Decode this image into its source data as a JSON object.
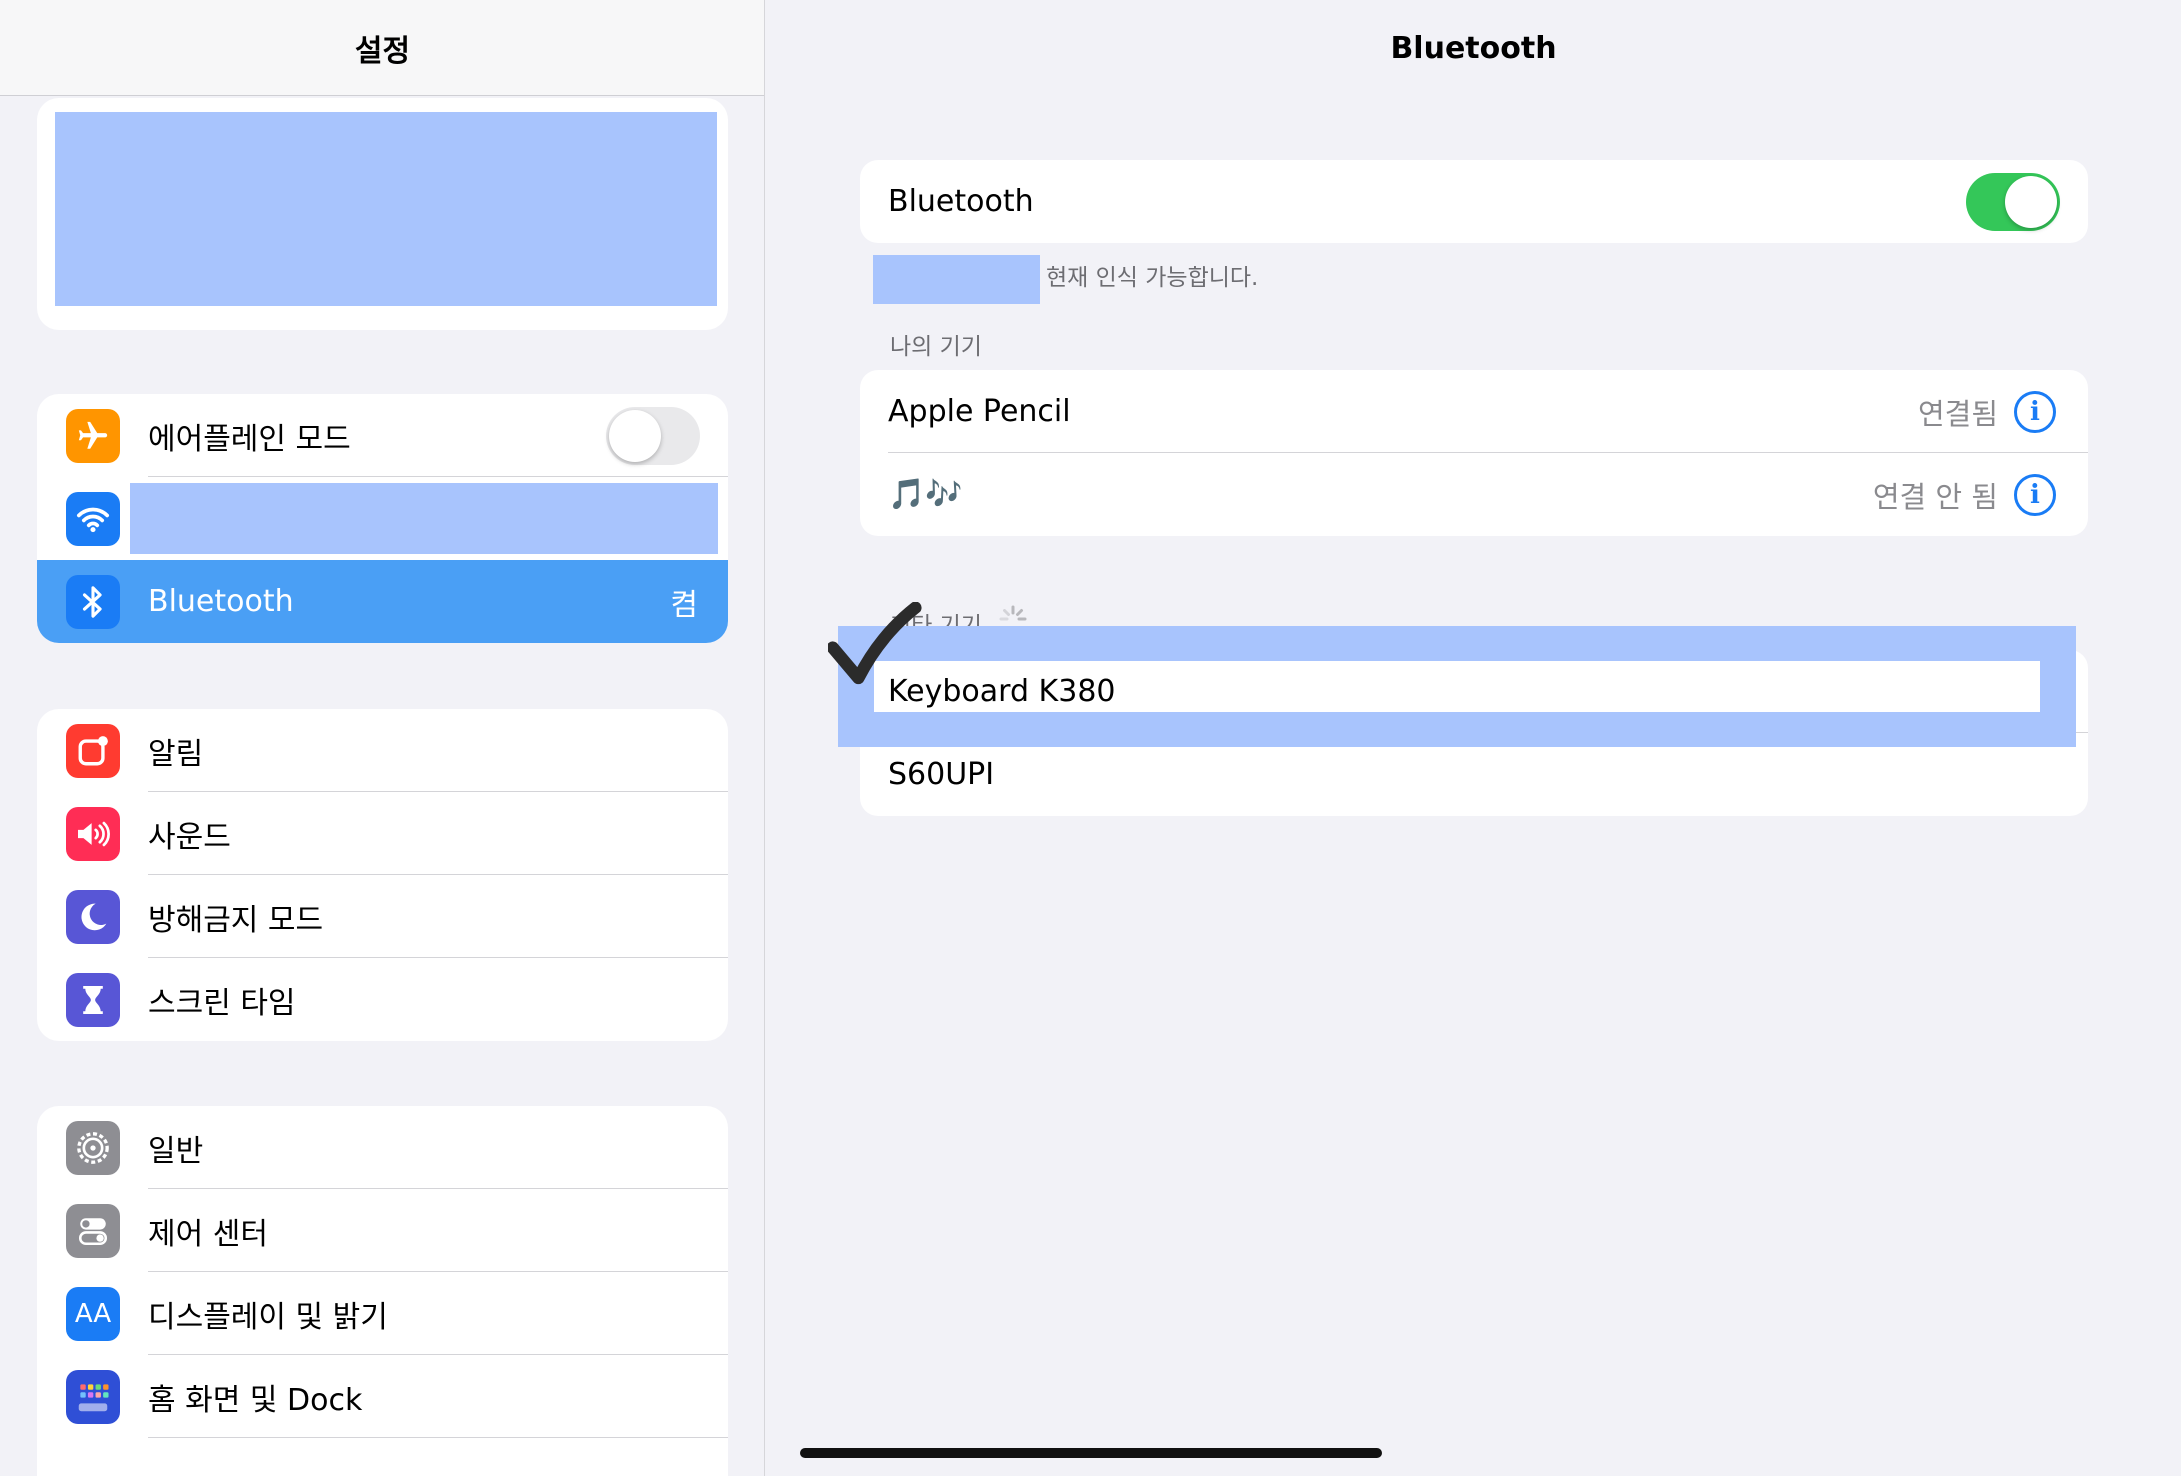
{
  "sidebar": {
    "title": "설정",
    "connectivity": [
      {
        "label": "에어플레인 모드",
        "toggle": "off",
        "icon": "airplane-icon",
        "color": "#ff9500"
      },
      {
        "label": "",
        "icon": "wifi-icon",
        "color": "#1a7cf5"
      },
      {
        "label": "Bluetooth",
        "value": "켬",
        "icon": "bluetooth-icon",
        "color": "#1a7cf5",
        "selected": true
      }
    ],
    "notifications": [
      {
        "label": "알림",
        "icon": "notifications-icon",
        "color": "#ff3b30"
      },
      {
        "label": "사운드",
        "icon": "sound-icon",
        "color": "#ff2d55"
      },
      {
        "label": "방해금지 모드",
        "icon": "moon-icon",
        "color": "#5856d6"
      },
      {
        "label": "스크린 타임",
        "icon": "hourglass-icon",
        "color": "#5856d6"
      }
    ],
    "general": [
      {
        "label": "일반",
        "icon": "gear-icon",
        "color": "#8e8e93"
      },
      {
        "label": "제어 센터",
        "icon": "control-center-icon",
        "color": "#8e8e93"
      },
      {
        "label": "디스플레이 및 밝기",
        "icon": "display-icon",
        "color": "#1a7cf5",
        "glyph": "AA"
      },
      {
        "label": "홈 화면 및 Dock",
        "icon": "home-screen-icon",
        "color": "#2f4fd6"
      }
    ]
  },
  "detail": {
    "title": "Bluetooth",
    "bluetooth_label": "Bluetooth",
    "bluetooth_toggle": "on",
    "discoverable_caption": "현재 인식 가능합니다.",
    "my_devices_header": "나의 기기",
    "my_devices": [
      {
        "name": "Apple Pencil",
        "status": "연결됨"
      },
      {
        "name": "🎵🎶",
        "status": "연결 안 됨"
      }
    ],
    "other_devices_header": "기타 기기",
    "other_devices": [
      {
        "name": "Keyboard K380"
      },
      {
        "name": "S60UPI"
      }
    ],
    "info_glyph": "i"
  },
  "colors": {
    "accent": "#1a7cf5",
    "selected_row": "#4a9ff5",
    "toggle_on": "#34c759",
    "redaction": "#a8c4fd"
  }
}
